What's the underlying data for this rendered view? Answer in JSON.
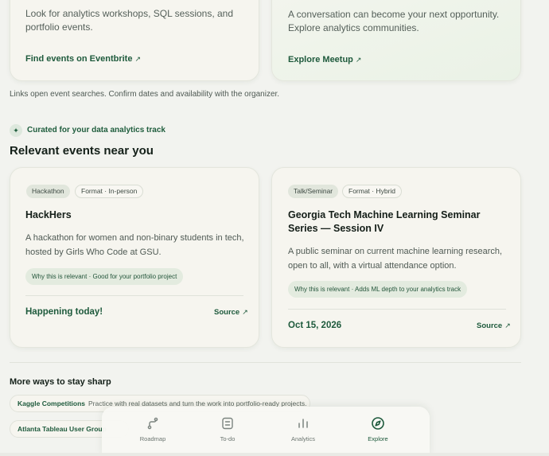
{
  "top_cards": [
    {
      "description": "Look for analytics workshops, SQL sessions, and portfolio events.",
      "link": "Find events on Eventbrite"
    },
    {
      "description": "A conversation can become your next opportunity. Explore analytics communities.",
      "link": "Explore Meetup"
    }
  ],
  "external_glyph": "↗",
  "note": "Links open event searches. Confirm dates and availability with the organizer.",
  "curated": {
    "icon": "✦",
    "label": "Curated for your data analytics track"
  },
  "section_title": "Relevant events near you",
  "events": [
    {
      "type_tag": "Hackathon",
      "format_tag": "Format · In-person",
      "title": "HackHers",
      "description": "A hackathon for women and non-binary students in tech, hosted by Girls Who Code at GSU.",
      "why": "Why this is relevant · Good for your portfolio project",
      "date": "Happening today!",
      "source": "Source"
    },
    {
      "type_tag": "Talk/Seminar",
      "format_tag": "Format · Hybrid",
      "title": "Georgia Tech Machine Learning Seminar Series — Session IV",
      "description": "A public seminar on current machine learning research, open to all, with a virtual attendance option.",
      "why": "Why this is relevant · Adds ML depth to your analytics track",
      "date": "Oct 15, 2026",
      "source": "Source"
    }
  ],
  "more": {
    "title": "More ways to stay sharp",
    "items": [
      {
        "name": "Kaggle Competitions",
        "description": "Practice with real datasets and turn the work into portfolio-ready projects."
      },
      {
        "name": "Atlanta Tableau User Group",
        "description": ""
      }
    ]
  },
  "nav": {
    "items": [
      {
        "label": "Roadmap",
        "icon": "route-icon"
      },
      {
        "label": "To-do",
        "icon": "checklist-icon"
      },
      {
        "label": "Analytics",
        "icon": "bar-chart-icon"
      },
      {
        "label": "Explore",
        "icon": "compass-icon",
        "active": true
      }
    ]
  },
  "colors": {
    "accent": "#1e5a3c",
    "background": "#f2f3ef",
    "card": "#f6f5ef"
  }
}
